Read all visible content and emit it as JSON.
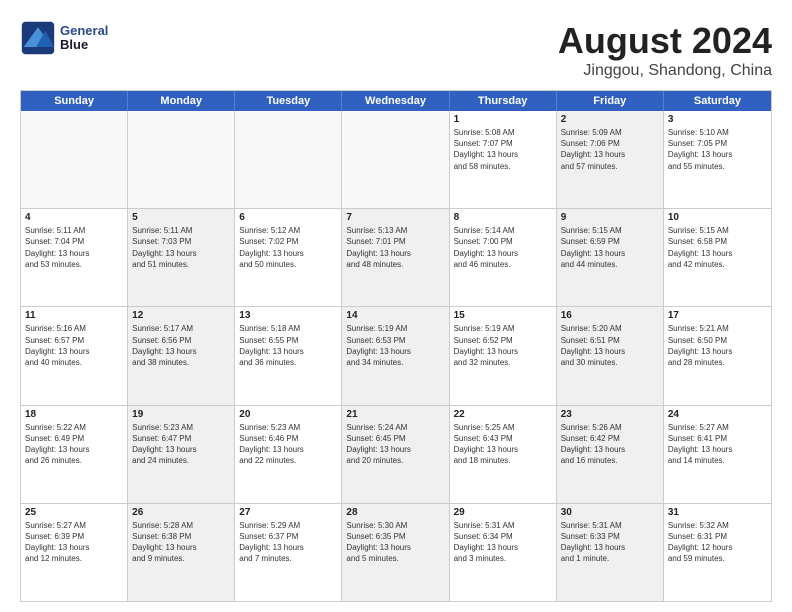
{
  "header": {
    "logo_line1": "General",
    "logo_line2": "Blue",
    "main_title": "August 2024",
    "subtitle": "Jinggou, Shandong, China"
  },
  "days_of_week": [
    "Sunday",
    "Monday",
    "Tuesday",
    "Wednesday",
    "Thursday",
    "Friday",
    "Saturday"
  ],
  "weeks": [
    [
      {
        "day": "",
        "text": "",
        "empty": true
      },
      {
        "day": "",
        "text": "",
        "empty": true
      },
      {
        "day": "",
        "text": "",
        "empty": true
      },
      {
        "day": "",
        "text": "",
        "empty": true
      },
      {
        "day": "1",
        "text": "Sunrise: 5:08 AM\nSunset: 7:07 PM\nDaylight: 13 hours\nand 58 minutes.",
        "empty": false
      },
      {
        "day": "2",
        "text": "Sunrise: 5:09 AM\nSunset: 7:06 PM\nDaylight: 13 hours\nand 57 minutes.",
        "empty": false,
        "shaded": true
      },
      {
        "day": "3",
        "text": "Sunrise: 5:10 AM\nSunset: 7:05 PM\nDaylight: 13 hours\nand 55 minutes.",
        "empty": false
      }
    ],
    [
      {
        "day": "4",
        "text": "Sunrise: 5:11 AM\nSunset: 7:04 PM\nDaylight: 13 hours\nand 53 minutes.",
        "empty": false
      },
      {
        "day": "5",
        "text": "Sunrise: 5:11 AM\nSunset: 7:03 PM\nDaylight: 13 hours\nand 51 minutes.",
        "empty": false,
        "shaded": true
      },
      {
        "day": "6",
        "text": "Sunrise: 5:12 AM\nSunset: 7:02 PM\nDaylight: 13 hours\nand 50 minutes.",
        "empty": false
      },
      {
        "day": "7",
        "text": "Sunrise: 5:13 AM\nSunset: 7:01 PM\nDaylight: 13 hours\nand 48 minutes.",
        "empty": false,
        "shaded": true
      },
      {
        "day": "8",
        "text": "Sunrise: 5:14 AM\nSunset: 7:00 PM\nDaylight: 13 hours\nand 46 minutes.",
        "empty": false
      },
      {
        "day": "9",
        "text": "Sunrise: 5:15 AM\nSunset: 6:59 PM\nDaylight: 13 hours\nand 44 minutes.",
        "empty": false,
        "shaded": true
      },
      {
        "day": "10",
        "text": "Sunrise: 5:15 AM\nSunset: 6:58 PM\nDaylight: 13 hours\nand 42 minutes.",
        "empty": false
      }
    ],
    [
      {
        "day": "11",
        "text": "Sunrise: 5:16 AM\nSunset: 6:57 PM\nDaylight: 13 hours\nand 40 minutes.",
        "empty": false
      },
      {
        "day": "12",
        "text": "Sunrise: 5:17 AM\nSunset: 6:56 PM\nDaylight: 13 hours\nand 38 minutes.",
        "empty": false,
        "shaded": true
      },
      {
        "day": "13",
        "text": "Sunrise: 5:18 AM\nSunset: 6:55 PM\nDaylight: 13 hours\nand 36 minutes.",
        "empty": false
      },
      {
        "day": "14",
        "text": "Sunrise: 5:19 AM\nSunset: 6:53 PM\nDaylight: 13 hours\nand 34 minutes.",
        "empty": false,
        "shaded": true
      },
      {
        "day": "15",
        "text": "Sunrise: 5:19 AM\nSunset: 6:52 PM\nDaylight: 13 hours\nand 32 minutes.",
        "empty": false
      },
      {
        "day": "16",
        "text": "Sunrise: 5:20 AM\nSunset: 6:51 PM\nDaylight: 13 hours\nand 30 minutes.",
        "empty": false,
        "shaded": true
      },
      {
        "day": "17",
        "text": "Sunrise: 5:21 AM\nSunset: 6:50 PM\nDaylight: 13 hours\nand 28 minutes.",
        "empty": false
      }
    ],
    [
      {
        "day": "18",
        "text": "Sunrise: 5:22 AM\nSunset: 6:49 PM\nDaylight: 13 hours\nand 26 minutes.",
        "empty": false
      },
      {
        "day": "19",
        "text": "Sunrise: 5:23 AM\nSunset: 6:47 PM\nDaylight: 13 hours\nand 24 minutes.",
        "empty": false,
        "shaded": true
      },
      {
        "day": "20",
        "text": "Sunrise: 5:23 AM\nSunset: 6:46 PM\nDaylight: 13 hours\nand 22 minutes.",
        "empty": false
      },
      {
        "day": "21",
        "text": "Sunrise: 5:24 AM\nSunset: 6:45 PM\nDaylight: 13 hours\nand 20 minutes.",
        "empty": false,
        "shaded": true
      },
      {
        "day": "22",
        "text": "Sunrise: 5:25 AM\nSunset: 6:43 PM\nDaylight: 13 hours\nand 18 minutes.",
        "empty": false
      },
      {
        "day": "23",
        "text": "Sunrise: 5:26 AM\nSunset: 6:42 PM\nDaylight: 13 hours\nand 16 minutes.",
        "empty": false,
        "shaded": true
      },
      {
        "day": "24",
        "text": "Sunrise: 5:27 AM\nSunset: 6:41 PM\nDaylight: 13 hours\nand 14 minutes.",
        "empty": false
      }
    ],
    [
      {
        "day": "25",
        "text": "Sunrise: 5:27 AM\nSunset: 6:39 PM\nDaylight: 13 hours\nand 12 minutes.",
        "empty": false
      },
      {
        "day": "26",
        "text": "Sunrise: 5:28 AM\nSunset: 6:38 PM\nDaylight: 13 hours\nand 9 minutes.",
        "empty": false,
        "shaded": true
      },
      {
        "day": "27",
        "text": "Sunrise: 5:29 AM\nSunset: 6:37 PM\nDaylight: 13 hours\nand 7 minutes.",
        "empty": false
      },
      {
        "day": "28",
        "text": "Sunrise: 5:30 AM\nSunset: 6:35 PM\nDaylight: 13 hours\nand 5 minutes.",
        "empty": false,
        "shaded": true
      },
      {
        "day": "29",
        "text": "Sunrise: 5:31 AM\nSunset: 6:34 PM\nDaylight: 13 hours\nand 3 minutes.",
        "empty": false
      },
      {
        "day": "30",
        "text": "Sunrise: 5:31 AM\nSunset: 6:33 PM\nDaylight: 13 hours\nand 1 minute.",
        "empty": false,
        "shaded": true
      },
      {
        "day": "31",
        "text": "Sunrise: 5:32 AM\nSunset: 6:31 PM\nDaylight: 12 hours\nand 59 minutes.",
        "empty": false
      }
    ]
  ]
}
